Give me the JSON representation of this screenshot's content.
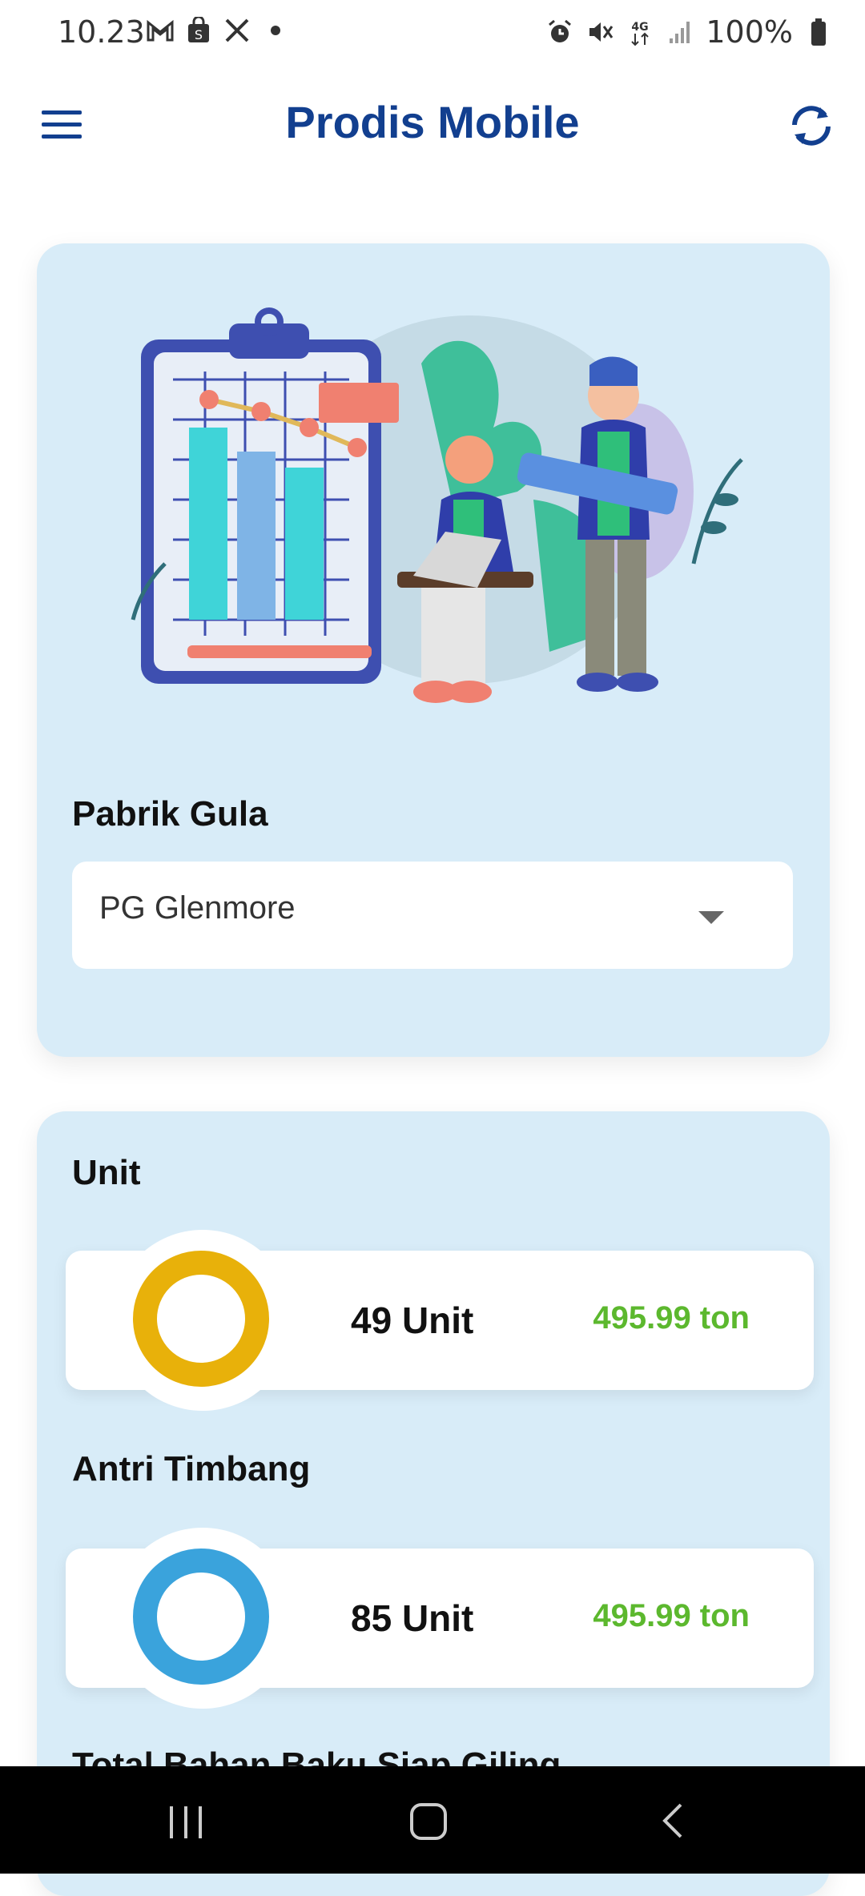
{
  "status_bar": {
    "time": "10.23",
    "battery": "100%",
    "network": "4G"
  },
  "app_bar": {
    "title": "Prodis Mobile"
  },
  "top_card": {
    "field_label": "Pabrik Gula",
    "selected_value": "PG Glenmore"
  },
  "stats": {
    "unit": {
      "label": "Unit",
      "count": "49 Unit",
      "tonnage": "495.99 ton",
      "ring_color": "#e8b10a"
    },
    "antri": {
      "label": "Antri Timbang",
      "count": "85 Unit",
      "tonnage": "495.99 ton",
      "ring_color": "#3aa3dc"
    },
    "next_label": "Total Bahan Baku Siap Giling"
  },
  "colors": {
    "brand": "#123f8f",
    "card_bg": "#d8ecf8",
    "tonnage": "#5cb82e"
  },
  "icons": [
    "menu-icon",
    "refresh-icon",
    "gmail-icon",
    "shop-icon",
    "x-icon",
    "alarm-icon",
    "mute-icon",
    "battery-icon",
    "recents-icon",
    "home-icon",
    "back-icon"
  ]
}
